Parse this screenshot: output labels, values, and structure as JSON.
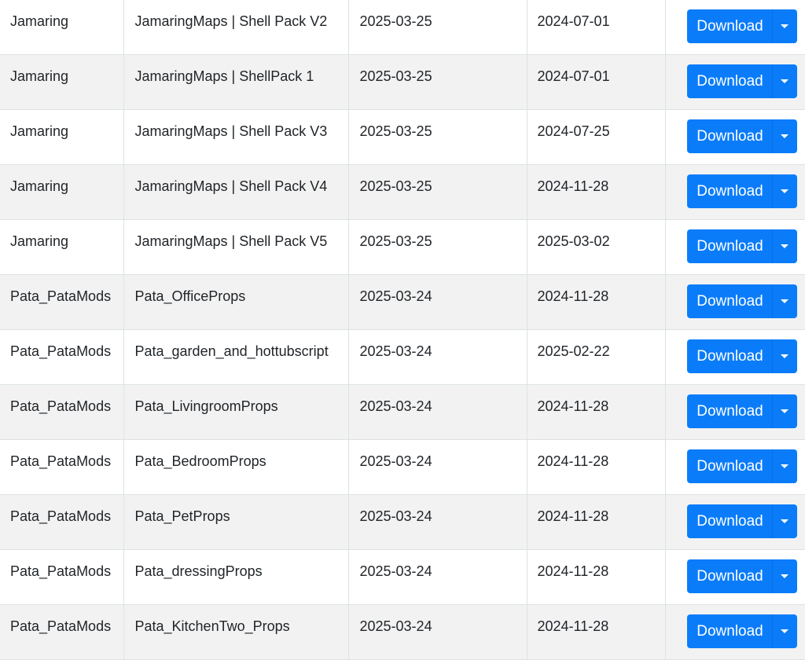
{
  "colors": {
    "button_bg": "#0a7cfa",
    "button_text": "#ffffff",
    "row_stripe": "#f2f2f2",
    "border": "#dee2e6"
  },
  "download_label": "Download",
  "rows": [
    {
      "author": "Jamaring",
      "name": "JamaringMaps | Shell Pack V2",
      "updated": "2025-03-25",
      "created": "2024-07-01",
      "action": "Download"
    },
    {
      "author": "Jamaring",
      "name": "JamaringMaps | ShellPack 1",
      "updated": "2025-03-25",
      "created": "2024-07-01",
      "action": "Download"
    },
    {
      "author": "Jamaring",
      "name": "JamaringMaps | Shell Pack V3",
      "updated": "2025-03-25",
      "created": "2024-07-25",
      "action": "Download"
    },
    {
      "author": "Jamaring",
      "name": "JamaringMaps | Shell Pack V4",
      "updated": "2025-03-25",
      "created": "2024-11-28",
      "action": "Download"
    },
    {
      "author": "Jamaring",
      "name": "JamaringMaps | Shell Pack V5",
      "updated": "2025-03-25",
      "created": "2025-03-02",
      "action": "Download"
    },
    {
      "author": "Pata_PataMods",
      "name": "Pata_OfficeProps",
      "updated": "2025-03-24",
      "created": "2024-11-28",
      "action": "Download"
    },
    {
      "author": "Pata_PataMods",
      "name": "Pata_garden_and_hottubscript",
      "updated": "2025-03-24",
      "created": "2025-02-22",
      "action": "Download"
    },
    {
      "author": "Pata_PataMods",
      "name": "Pata_LivingroomProps",
      "updated": "2025-03-24",
      "created": "2024-11-28",
      "action": "Download"
    },
    {
      "author": "Pata_PataMods",
      "name": "Pata_BedroomProps",
      "updated": "2025-03-24",
      "created": "2024-11-28",
      "action": "Download"
    },
    {
      "author": "Pata_PataMods",
      "name": "Pata_PetProps",
      "updated": "2025-03-24",
      "created": "2024-11-28",
      "action": "Download"
    },
    {
      "author": "Pata_PataMods",
      "name": "Pata_dressingProps",
      "updated": "2025-03-24",
      "created": "2024-11-28",
      "action": "Download"
    },
    {
      "author": "Pata_PataMods",
      "name": "Pata_KitchenTwo_Props",
      "updated": "2025-03-24",
      "created": "2024-11-28",
      "action": "Download"
    }
  ]
}
